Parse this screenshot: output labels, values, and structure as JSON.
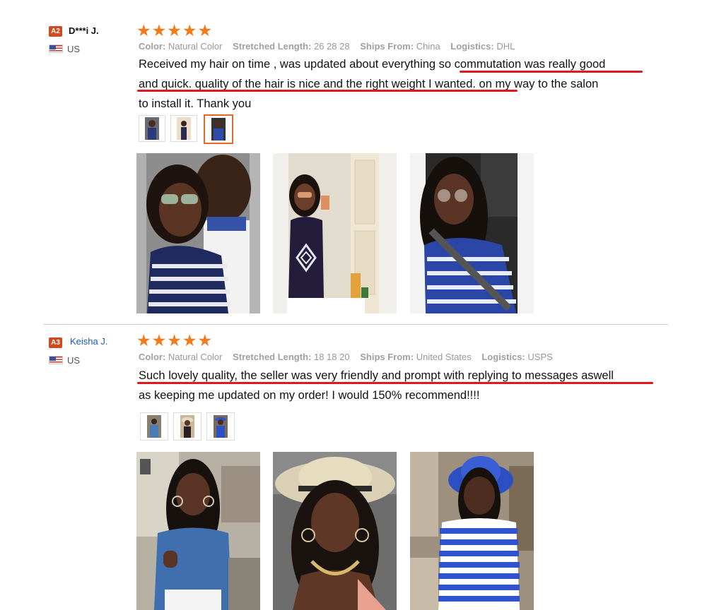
{
  "reviews": [
    {
      "badge": "A2",
      "username": "D***i J.",
      "country": "US",
      "stars": "★★★★★",
      "color_label": "Color:",
      "color_value": "Natural Color",
      "length_label": "Stretched Length:",
      "length_value": "26 28 28",
      "ships_label": "Ships From:",
      "ships_value": "China",
      "logistics_label": "Logistics:",
      "logistics_value": "DHL",
      "text_line1": "Received my hair on time , was updated about everything so commutation was really good",
      "text_line2": "and quick. quality of the hair is nice and the right weight I wanted. on my way to the salon",
      "text_line3": "to install it. Thank you",
      "photo_count": 3,
      "selected_thumb": 3
    },
    {
      "badge": "A3",
      "username": "Keisha J.",
      "country": "US",
      "stars": "★★★★★",
      "color_label": "Color:",
      "color_value": "Natural Color",
      "length_label": "Stretched Length:",
      "length_value": "18 18 20",
      "ships_label": "Ships From:",
      "ships_value": "United States",
      "logistics_label": "Logistics:",
      "logistics_value": "USPS",
      "text_line1": "Such lovely quality, the seller was very friendly and prompt with replying to messages aswell",
      "text_line2": "as keeping me updated on my order! I would 150% recommend!!!!",
      "photo_count": 3
    }
  ],
  "colors": {
    "badge": "#d4481f",
    "star": "#f27a1a",
    "underline": "#e0171f",
    "username_link": "#1a5fb4",
    "selected_thumb_border": "#e06a26"
  },
  "icons": [
    "us-flag-icon",
    "star-icon"
  ]
}
